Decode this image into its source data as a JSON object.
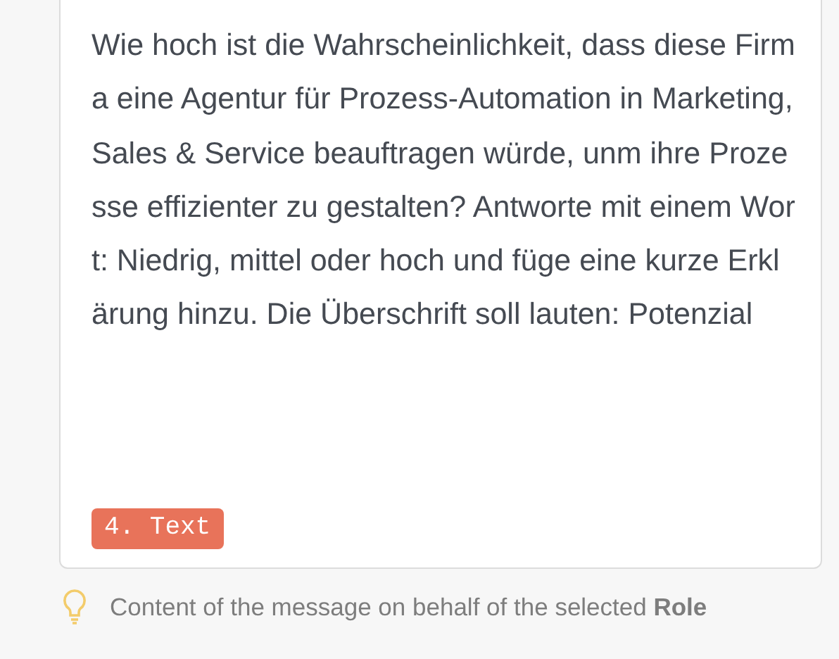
{
  "message": {
    "text": "Wie hoch ist die Wahrscheinlichkeit, dass diese Firma eine Agentur für Prozess-Automation in Marketing, Sales & Service beauftragen würde, unm ihre Prozesse effizienter zu gestalten? Antworte mit einem Wort: Niedrig, mittel oder hoch und füge eine kurze Erklärung hinzu. Die Überschrift soll lauten: Potenzial",
    "tag": {
      "label": "4. Text",
      "color": "#e8735a"
    }
  },
  "hint": {
    "text": "Content of the message on behalf of the selected **Role**"
  }
}
